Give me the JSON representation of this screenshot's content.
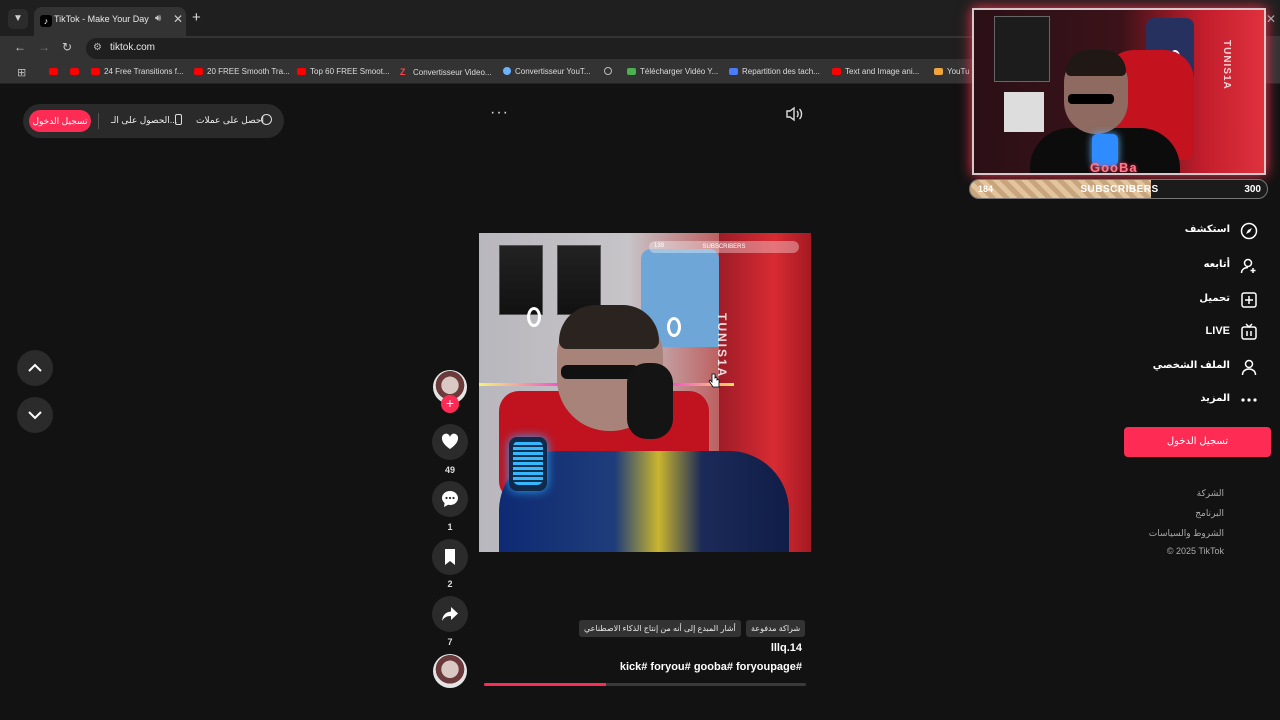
{
  "browser": {
    "tab_title": "TikTok - Make Your Day",
    "url": "tiktok.com",
    "bookmarks": [
      "24 Free Transitions f...",
      "20 FREE Smooth Tra...",
      "Top 60 FREE Smoot...",
      "Convertisseur Video...",
      "Convertisseur YouT...",
      "Télécharger Vidéo Y...",
      "Repartition des tach...",
      "Text and Image ani...",
      "YouTu"
    ]
  },
  "topbar": {
    "login_label": "تسجيل الدخول",
    "get_app_label": "الحصول على الـ...",
    "get_coins_label": "احصل على عملات",
    "more_dots": "···"
  },
  "post": {
    "likes": "49",
    "comments": "1",
    "saves": "2",
    "shares": "7",
    "paid_partnership": "شراكة مدفوعة",
    "ai_label": "أشار المبدع إلى أنه من إنتاج الذكاء الاصطناعي",
    "author": "lllq.14",
    "hashtags": "kick#  foryou#  gooba#  foryoupage#",
    "progress": 0.38,
    "overlay_subs_count": "139",
    "overlay_subs_label": "SUBSCRIBERS",
    "wall_text": "TUNIS1A"
  },
  "sidebar": {
    "items": [
      {
        "label": "استكشف",
        "icon": "compass-icon"
      },
      {
        "label": "أتابعه",
        "icon": "user-plus-icon"
      },
      {
        "label": "تحميل",
        "icon": "upload-icon"
      },
      {
        "label": "LIVE",
        "icon": "live-tv-icon"
      },
      {
        "label": "الملف الشخصي",
        "icon": "profile-icon"
      },
      {
        "label": "المزيد",
        "icon": "more-icon"
      }
    ],
    "login_button": "تسجيل الدخول",
    "footer": [
      "الشركة",
      "البرنامج",
      "الشروط والسياسات",
      "© 2025 TikTok"
    ]
  },
  "webcam": {
    "logo": "GooBa",
    "side_text": "TUNIS1A",
    "subs_current": "184",
    "subs_label": "SUBSCRIBERS",
    "subs_goal": "300",
    "subs_fraction": 0.61
  },
  "colors": {
    "accent": "#fe2c55",
    "background": "#121212"
  }
}
